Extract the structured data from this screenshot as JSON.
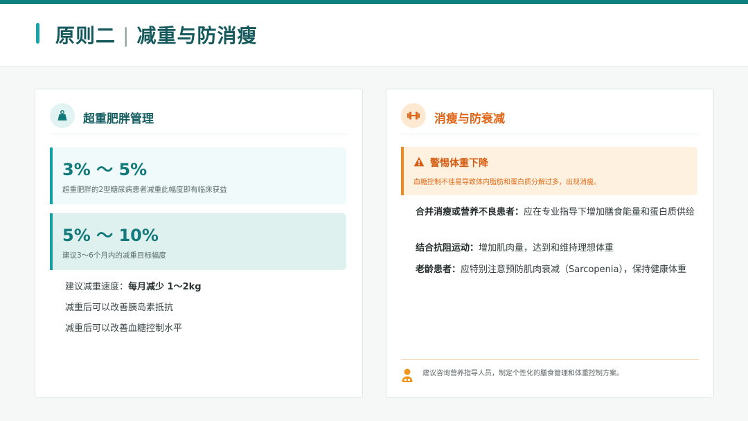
{
  "header": {
    "title_left": "原则二",
    "separator": "|",
    "title_right": "减重与防消瘦"
  },
  "colors": {
    "teal_dark": "#155f63",
    "teal_accent": "#14a0a5",
    "orange": "#e0661a",
    "warning_bg": "#fff1df"
  },
  "left_card": {
    "icon": "weight-icon",
    "title": "超重肥胖管理",
    "stats": [
      {
        "value": "3% ～ 5%",
        "desc": "超重肥胖的2型糖尿病患者减重此幅度即有临床获益"
      },
      {
        "value": "5% ～ 10%",
        "desc": "建议3～6个月内的减重目标幅度"
      }
    ],
    "bullets": {
      "speed_label": "建议减重速度：",
      "speed_value": "每月减少 1～2kg",
      "item2": "减重后可以改善胰岛素抵抗",
      "item3": "减重后可以改善血糖控制水平"
    }
  },
  "right_card": {
    "icon": "dumbbell-icon",
    "title": "消瘦与防衰减",
    "warning": {
      "icon": "warning-triangle-icon",
      "title": "警惕体重下降",
      "desc": "血糖控制不佳易导致体内脂肪和蛋白质分解过多，出现消瘦。"
    },
    "advice": [
      {
        "label": "合并消瘦或营养不良患者：",
        "text": "应在专业指导下增加膳食能量和蛋白质供给"
      },
      {
        "label": "结合抗阻运动：",
        "text": "增加肌肉量，达到和维持理想体重"
      },
      {
        "label": "老龄患者：",
        "text": "应特别注意预防肌肉衰减（Sarcopenia），保持健康体重"
      }
    ],
    "footer": {
      "icon": "nutritionist-icon",
      "text": "建议咨询营养指导人员，制定个性化的膳食管理和体重控制方案。"
    }
  }
}
